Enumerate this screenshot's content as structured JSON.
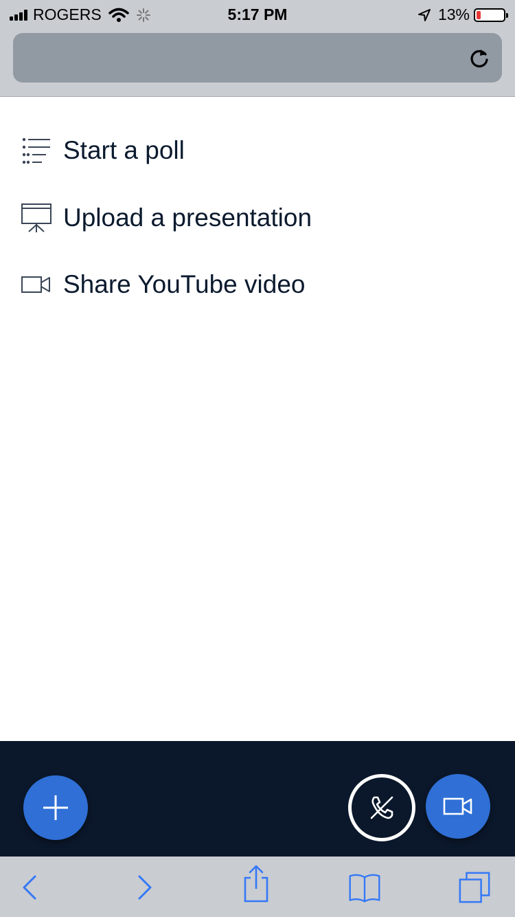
{
  "status": {
    "carrier": "ROGERS",
    "time": "5:17 PM",
    "battery": "13%",
    "battery_level": 0.13
  },
  "menu": {
    "items": [
      {
        "label": "Start a poll",
        "icon": "list-icon"
      },
      {
        "label": "Upload a presentation",
        "icon": "presentation-icon"
      },
      {
        "label": "Share YouTube video",
        "icon": "video-camera-icon"
      }
    ]
  },
  "colors": {
    "accent": "#2f6fd6",
    "action_bar": "#0b182b",
    "text": "#0b1a2e",
    "ios_blue": "#3478f6",
    "chrome_gray": "#c9ccd1"
  }
}
